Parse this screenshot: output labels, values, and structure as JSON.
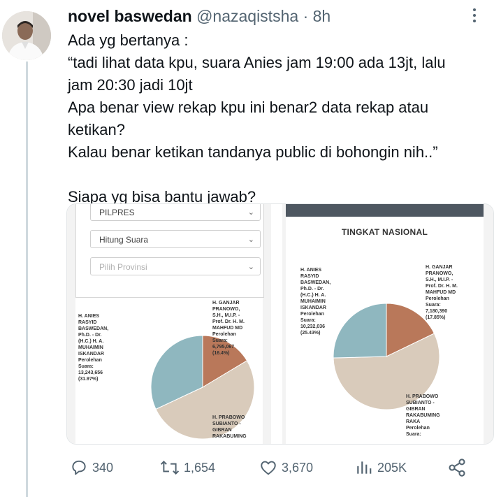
{
  "tweet": {
    "display_name": "novel baswedan",
    "handle": "@nazaqistsha",
    "separator": "·",
    "time": "8h",
    "body": {
      "line1": "Ada yg bertanya :",
      "line2": "“tadi lihat data kpu, suara Anies jam 19:00 ada 13jt, lalu",
      "line3": "jam 20:30 jadi 10jt",
      "line4": "Apa benar view rekap kpu ini benar2 data rekap atau",
      "line5": "ketikan?",
      "line6": "Kalau benar ketikan tandanya public di bohongin nih..”",
      "line7": "Siapa yg bisa bantu jawab?"
    }
  },
  "media": {
    "left": {
      "selects": [
        {
          "value": "PILPRES"
        },
        {
          "value": "Hitung Suara"
        },
        {
          "placeholder": "Pilih Provinsi"
        }
      ],
      "labels": {
        "anies": "H. ANIES\nRASYID\nBASWEDAN,\nPh.D. - Dr.\n(H.C.) H. A.\nMUHAIMIN\nISKANDAR\nPerolehan\nSuara:\n13,243,656\n(31.97%)",
        "ganjar": "H. GANJAR\nPRANOWO,\nS.H., M.I.P. -\nProf. Dr. H. M.\nMAHFUD MD\nPerolehan\nSuara:\n6,795,067\n(16.4%)",
        "prabowo": "H. PRABOWO\nSUBIANTO -\nGIBRAN\nRAKABUMING"
      }
    },
    "right": {
      "title": "TINGKAT NASIONAL",
      "labels": {
        "anies": "H. ANIES\nRASYID\nBASWEDAN,\nPh.D. - Dr.\n(H.C.) H. A.\nMUHAIMIN\nISKANDAR\nPerolehan\nSuara:\n10,232,036\n(25.43%)",
        "ganjar": "H. GANJAR\nPRANOWO,\nS.H., M.I.P. -\nProf. Dr. H. M.\nMAHFUD MD\nPerolehan\nSuara:\n7,180,390\n(17.85%)",
        "prabowo": "H. PRABOWO\nSUBIANTO -\nGIBRAN\nRAKABUMING\nRAKA\nPerolehan\nSuara:"
      }
    },
    "colors": {
      "anies": "#8fb7bf",
      "ganjar": "#b9785a",
      "prabowo": "#d9cbbb"
    }
  },
  "chart_data": [
    {
      "type": "pie",
      "categories": [
        "Anies-Muhaimin",
        "Ganjar-Mahfud",
        "Prabowo-Gibran"
      ],
      "values": [
        31.97,
        16.4,
        51.63
      ]
    },
    {
      "type": "pie",
      "categories": [
        "Anies-Muhaimin",
        "Ganjar-Mahfud",
        "Prabowo-Gibran"
      ],
      "values": [
        25.43,
        17.85,
        56.72
      ]
    }
  ],
  "actions": {
    "replies": "340",
    "reposts": "1,654",
    "likes": "3,670",
    "views": "205K",
    "icons": [
      "reply-icon",
      "repost-icon",
      "like-icon",
      "views-icon",
      "share-icon"
    ]
  }
}
